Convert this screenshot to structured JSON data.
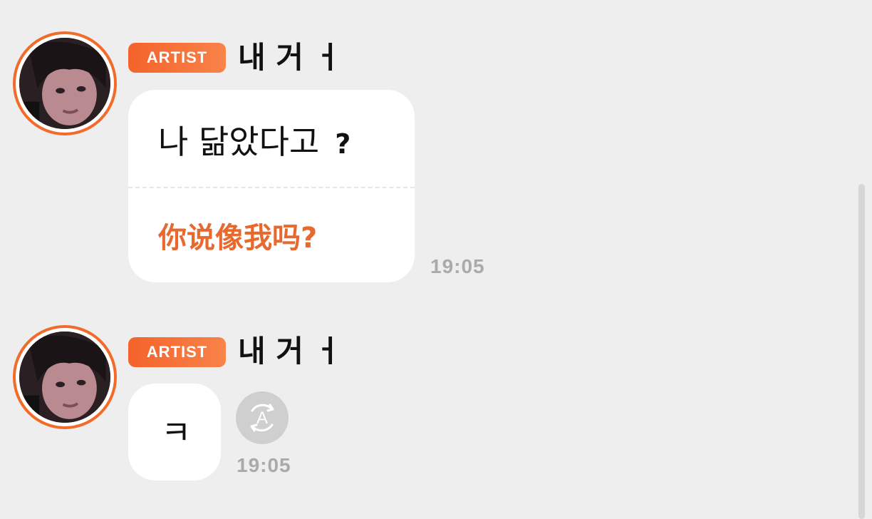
{
  "messages": [
    {
      "badge": "ARTIST",
      "username": "내 거 ㅓ",
      "original": "나 닮았다고",
      "original_punct": "?",
      "translation": "你说像我吗?",
      "time": "19:05"
    },
    {
      "badge": "ARTIST",
      "username": "내 거 ㅓ",
      "original": "ㅋ",
      "time": "19:05",
      "translate_icon": "translate-icon"
    }
  ],
  "colors": {
    "accent": "#f26b2b",
    "translation_text": "#e8692e",
    "background": "#eeeeee",
    "bubble": "#ffffff",
    "timestamp": "#aaaaaa"
  }
}
